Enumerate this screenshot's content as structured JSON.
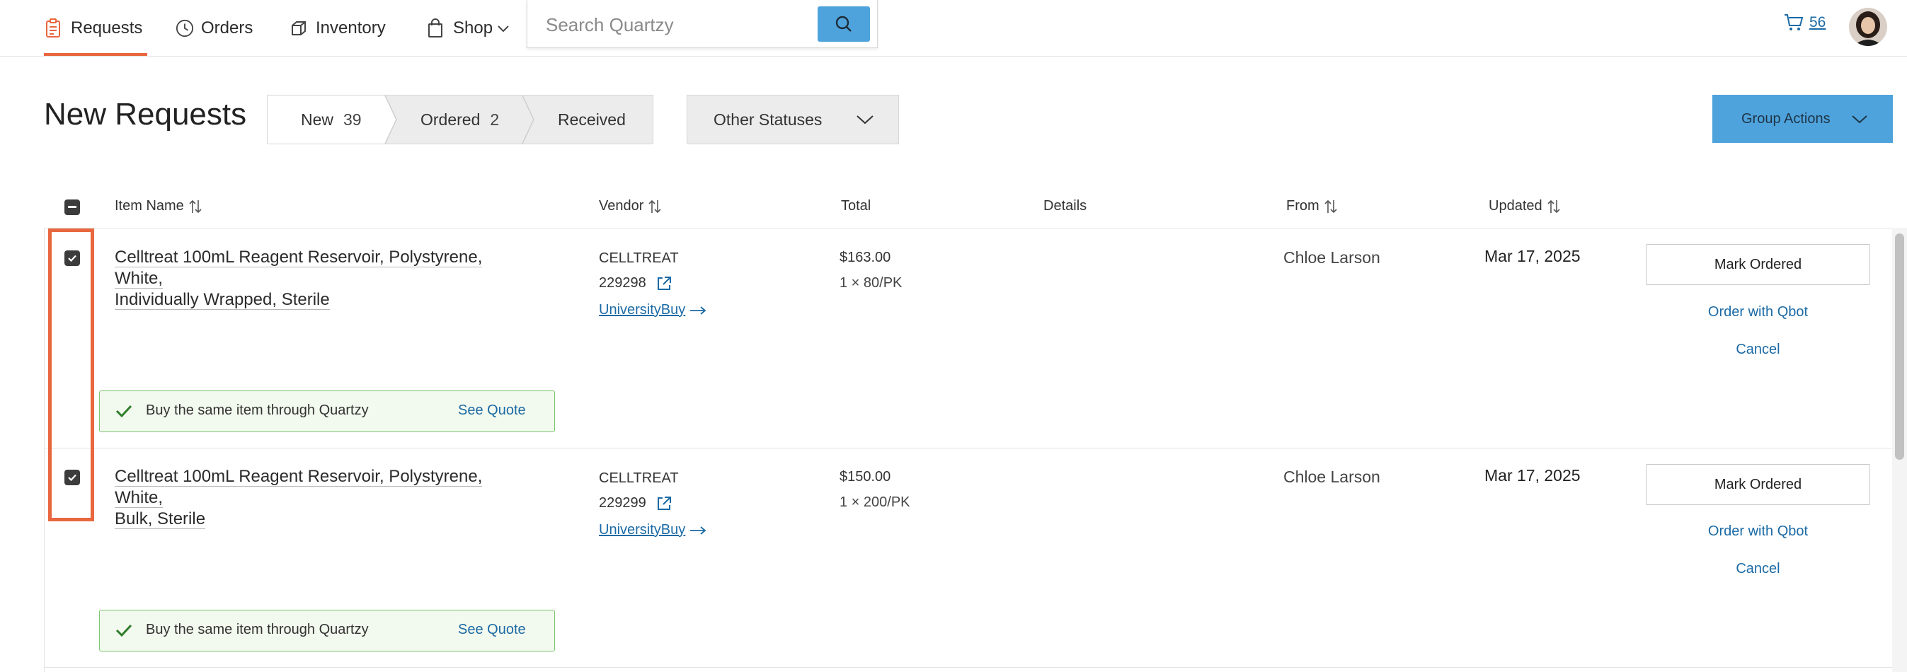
{
  "nav": {
    "requests_label": "Requests",
    "orders_label": "Orders",
    "inventory_label": "Inventory",
    "shop_label": "Shop",
    "search_placeholder": "Search Quartzy",
    "cart_count": "56",
    "accent_color": "#e8673e"
  },
  "header": {
    "title": "New Requests",
    "tabs": [
      {
        "label": "New",
        "count": "39"
      },
      {
        "label": "Ordered",
        "count": "2"
      },
      {
        "label": "Received",
        "count": ""
      }
    ],
    "other_statuses_label": "Other Statuses",
    "group_actions_label": "Group Actions"
  },
  "table": {
    "columns": {
      "item_name": "Item Name",
      "vendor": "Vendor",
      "total": "Total",
      "details": "Details",
      "from": "From",
      "updated": "Updated"
    },
    "rows": [
      {
        "checked": true,
        "item_name_line1": "Celltreat 100mL Reagent Reservoir, Polystyrene, White,",
        "item_name_line2": "Individually Wrapped, Sterile",
        "vendor": "CELLTREAT",
        "catalog": "229298",
        "vendor_link": "UniversityBuy",
        "total": "$163.00",
        "pack": "1 × 80/PK",
        "details": "",
        "from": "Chloe Larson",
        "updated": "Mar 17, 2025",
        "mark_ordered_label": "Mark Ordered",
        "order_qbot_label": "Order with Qbot",
        "cancel_label": "Cancel",
        "quote_text": "Buy the same item through Quartzy",
        "quote_link": "See Quote"
      },
      {
        "checked": true,
        "item_name_line1": "Celltreat 100mL Reagent Reservoir, Polystyrene, White,",
        "item_name_line2": "Bulk, Sterile",
        "vendor": "CELLTREAT",
        "catalog": "229299",
        "vendor_link": "UniversityBuy",
        "total": "$150.00",
        "pack": "1 × 200/PK",
        "details": "",
        "from": "Chloe Larson",
        "updated": "Mar 17, 2025",
        "mark_ordered_label": "Mark Ordered",
        "order_qbot_label": "Order with Qbot",
        "cancel_label": "Cancel",
        "quote_text": "Buy the same item through Quartzy",
        "quote_link": "See Quote"
      }
    ]
  }
}
